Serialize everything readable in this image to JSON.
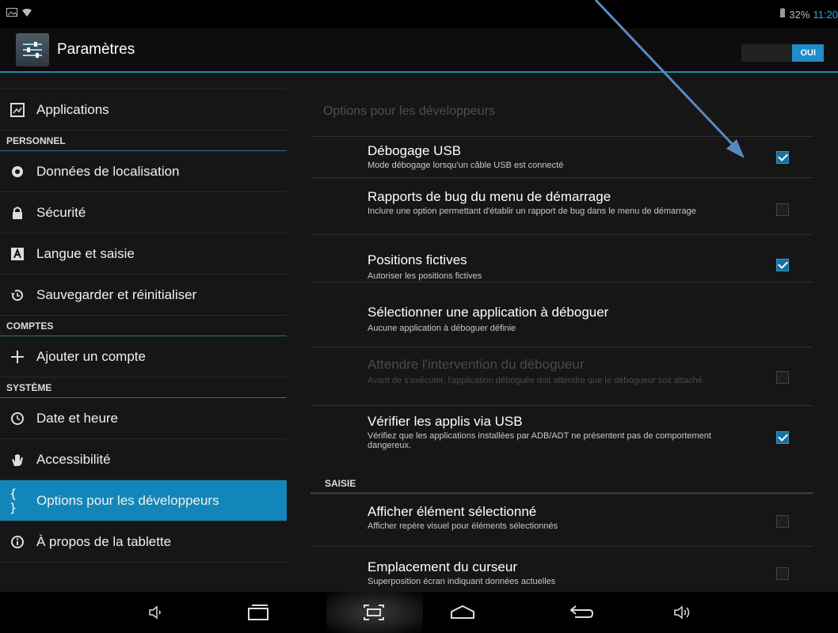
{
  "status_bar": {
    "battery_percent": "32%",
    "time": "11:20"
  },
  "action_bar": {
    "title": "Paramètres",
    "toggle_label": "OUI"
  },
  "sidebar": {
    "items": [
      {
        "icon": "apps-icon",
        "label": "Applications",
        "type": "item"
      },
      {
        "label": "PERSONNEL",
        "type": "header"
      },
      {
        "icon": "location-icon",
        "label": "Données de localisation",
        "type": "item"
      },
      {
        "icon": "lock-icon",
        "label": "Sécurité",
        "type": "item"
      },
      {
        "icon": "keyboard-icon",
        "label": "Langue et saisie",
        "type": "item"
      },
      {
        "icon": "restore-icon",
        "label": "Sauvegarder et réinitialiser",
        "type": "item"
      },
      {
        "label": "COMPTES",
        "type": "header"
      },
      {
        "icon": "plus-icon",
        "label": "Ajouter un compte",
        "type": "item"
      },
      {
        "label": "SYSTÈME",
        "type": "header"
      },
      {
        "icon": "clock-icon",
        "label": "Date et heure",
        "type": "item"
      },
      {
        "icon": "hand-icon",
        "label": "Accessibilité",
        "type": "item"
      },
      {
        "icon": "braces-icon",
        "label": "Options pour les développeurs",
        "type": "item",
        "active": true
      },
      {
        "icon": "info-icon",
        "label": "À propos de la tablette",
        "type": "item"
      }
    ]
  },
  "main": {
    "title": "Options pour les développeurs",
    "options": [
      {
        "title": "Débogage USB",
        "summary": "Mode débogage lorsqu'un câble USB est connecté",
        "checked": true,
        "disabled": false
      },
      {
        "title": "Rapports de bug du menu de démarrage",
        "summary": "Inclure une option permettant d'établir un rapport de bug dans le menu de démarrage",
        "checked": false,
        "disabled": false
      },
      {
        "title": "Positions fictives",
        "summary": "Autoriser les positions fictives",
        "checked": true,
        "disabled": false
      },
      {
        "title": "Sélectionner une application à déboguer",
        "summary": "Aucune application à déboguer définie",
        "checked": null,
        "disabled": false
      },
      {
        "title": "Attendre l'intervention du débogueur",
        "summary": "Avant de s'exécuter, l'application déboguée doit attendre que le débogueur soit attaché.",
        "checked": false,
        "disabled": true
      },
      {
        "title": "Vérifier les applis via USB",
        "summary": "Vérifiez que les applications installées par ADB/ADT ne présentent pas de comportement dangereux.",
        "checked": true,
        "disabled": false
      }
    ],
    "section_label": "SAISIE",
    "input_options": [
      {
        "title": "Afficher élément sélectionné",
        "summary": "Afficher repère visuel pour éléments sélectionnés",
        "checked": false,
        "disabled": false
      },
      {
        "title": "Emplacement du curseur",
        "summary": "Superposition écran indiquant données actuelles",
        "checked": false,
        "disabled": false
      }
    ]
  },
  "colors": {
    "accent": "#1386b9",
    "arrow": "#4a7ab8"
  }
}
